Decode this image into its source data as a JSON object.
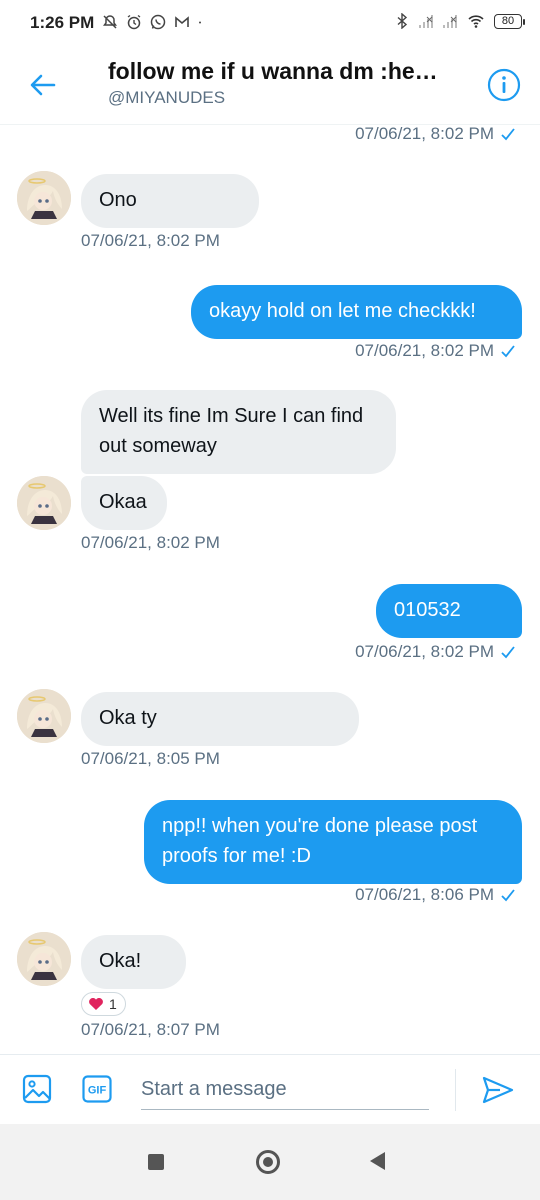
{
  "status_bar": {
    "time": "1:26 PM",
    "battery": "80",
    "left_icons": [
      "muted-bell-icon",
      "alarm-icon",
      "whatsapp-icon",
      "gmail-icon",
      "dot-icon"
    ],
    "right_icons": [
      "bluetooth-icon",
      "signal-icon",
      "signal-icon",
      "wifi-icon",
      "battery-icon"
    ]
  },
  "header": {
    "title": "follow me if u wanna dm :he…",
    "handle": "@MIYANUDES",
    "back_icon": "arrow-left-icon",
    "info_icon": "info-icon",
    "accent": "#1d9bf0"
  },
  "messages": {
    "top_timestamp": "07/06/21, 8:02 PM",
    "m1": {
      "text": "Ono",
      "time": "07/06/21, 8:02 PM"
    },
    "m2": {
      "text": "okayy hold on let me checkkk!",
      "time": "07/06/21, 8:02 PM"
    },
    "m3a": {
      "text": "Well its fine Im Sure I can find out someway"
    },
    "m3b": {
      "text": "Okaa",
      "time": "07/06/21, 8:02 PM"
    },
    "m4": {
      "text": "010532",
      "time": "07/06/21, 8:02 PM"
    },
    "m5": {
      "text": "Oka ty",
      "time": "07/06/21, 8:05 PM"
    },
    "m6": {
      "text": "npp!! when you're done please post proofs for me! :D",
      "time": "07/06/21, 8:06 PM"
    },
    "m7": {
      "text": "Oka!",
      "time": "07/06/21, 8:07 PM",
      "reaction_count": "1"
    }
  },
  "composer": {
    "placeholder": "Start a message",
    "gif_label": "GIF",
    "media_icon": "image-icon",
    "send_icon": "send-icon"
  },
  "colors": {
    "outgoing_bubble": "#1d9bf0",
    "incoming_bubble": "#ebeef0",
    "timestamp": "#5b7083"
  }
}
